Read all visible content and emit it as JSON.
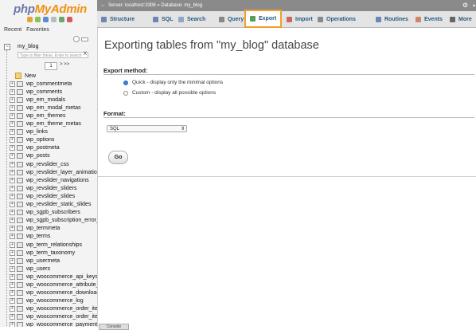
{
  "logo": {
    "part1": "php",
    "part2": "MyAdmin"
  },
  "nav": {
    "recent": "Recent",
    "favorites": "Favorites"
  },
  "database": {
    "name": "my_blog"
  },
  "filter": {
    "placeholder": "Type to filter these, Enter to search"
  },
  "filter_clear": "X",
  "pager": {
    "value": "1",
    "next": "> >>"
  },
  "tables": [
    "New",
    "wp_commentmeta",
    "wp_comments",
    "wp_em_modals",
    "wp_em_modal_metas",
    "wp_em_themes",
    "wp_em_theme_metas",
    "wp_links",
    "wp_options",
    "wp_postmeta",
    "wp_posts",
    "wp_revslider_css",
    "wp_revslider_layer_animation",
    "wp_revslider_navigations",
    "wp_revslider_sliders",
    "wp_revslider_slides",
    "wp_revslider_static_slides",
    "wp_sgpb_subscribers",
    "wp_sgpb_subscription_error_",
    "wp_termmeta",
    "wp_terms",
    "wp_term_relationships",
    "wp_term_taxonomy",
    "wp_usermeta",
    "wp_users",
    "wp_woocommerce_api_keys",
    "wp_woocommerce_attribute_",
    "wp_woocommerce_download",
    "wp_woocommerce_log",
    "wp_woocommerce_order_iter",
    "wp_woocommerce_order_iter",
    "wp_woocommerce_payment_"
  ],
  "topbar": {
    "server": "Server: localhost:3306",
    "database": "Database: my_blog",
    "sep": "»"
  },
  "tabs": [
    {
      "label": "Structure",
      "icon": "structure-icon"
    },
    {
      "label": "SQL",
      "icon": "sql-icon"
    },
    {
      "label": "Search",
      "icon": "search-icon"
    },
    {
      "label": "Query",
      "icon": "query-icon"
    },
    {
      "label": "Export",
      "icon": "export-icon",
      "active": true
    },
    {
      "label": "Import",
      "icon": "import-icon"
    },
    {
      "label": "Operations",
      "icon": "operations-icon"
    },
    {
      "label": "Routines",
      "icon": "routines-icon"
    },
    {
      "label": "Events",
      "icon": "events-icon"
    },
    {
      "label": "More",
      "icon": "chevron-down-icon"
    }
  ],
  "main": {
    "title": "Exporting tables from \"my_blog\" database",
    "export_method_label": "Export method:",
    "quick_option": "Quick - display only the minimal options",
    "custom_option": "Custom - display all possible options",
    "format_label": "Format:",
    "format_value": "SQL",
    "go_label": "Go"
  },
  "console": "Console",
  "colors": {
    "accent": "#f39c2a",
    "tab_text": "#235a81",
    "topbar": "#8a8a8a"
  }
}
